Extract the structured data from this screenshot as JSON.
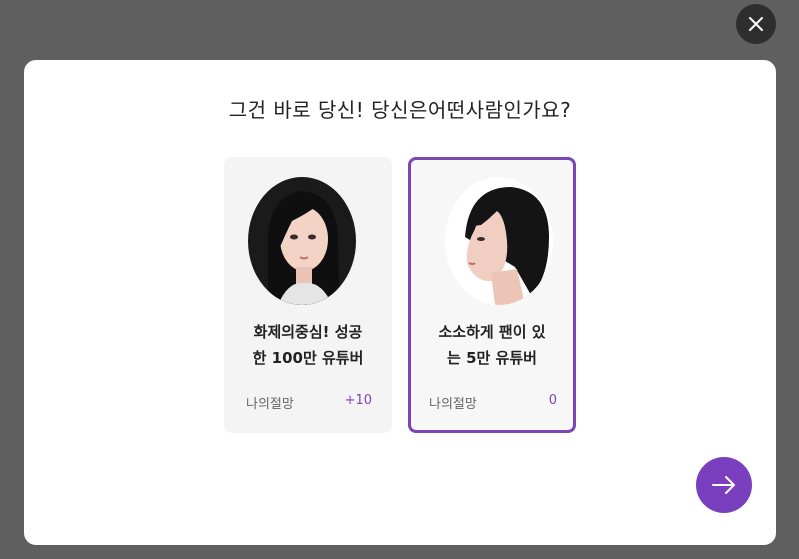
{
  "modal": {
    "title": "그건 바로 당신!  당신은어떤사람인가요?"
  },
  "cards": [
    {
      "line1": "화제의중심!  성공",
      "line2": "한 100만 유튜버",
      "stat_label": "나의절망",
      "stat_value": "+10",
      "selected": false
    },
    {
      "line1": "소소하게 팬이 있",
      "line2": "는 5만 유튜버",
      "stat_label": "나의절망",
      "stat_value": "0",
      "selected": true
    }
  ],
  "icons": {
    "close": "close-icon",
    "next": "arrow-right-icon"
  },
  "colors": {
    "overlay": "#5f5f5f",
    "accent": "#7a3fbf",
    "selected_border": "#7a45b5",
    "card_bg": "#f4f4f4"
  }
}
